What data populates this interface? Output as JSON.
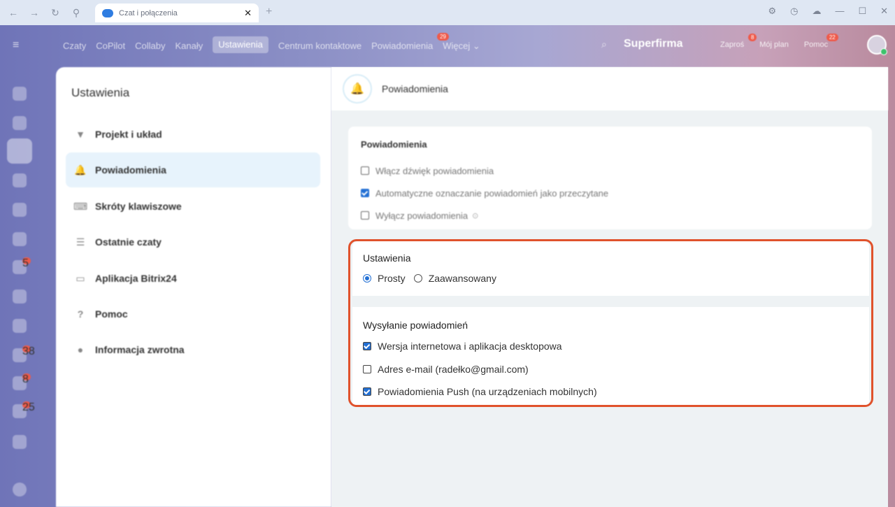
{
  "browser": {
    "tab_title": "Czat i połączenia"
  },
  "top_menu": {
    "items": [
      "Czaty",
      "CoPilot",
      "Collaby",
      "Kanały",
      "Ustawienia",
      "Centrum kontaktowe",
      "Powiadomienia",
      "Więcej ⌄"
    ],
    "notifications_badge": "29",
    "brand": "Superfirma",
    "invite": "Zaproś",
    "invite_badge": "8",
    "my_plan": "Mój plan",
    "help": "Pomoc",
    "help_badge": "22"
  },
  "rail": {
    "badges": [
      "5",
      "38",
      "8",
      "25"
    ]
  },
  "settings_panel": {
    "title": "Ustawienia",
    "items": [
      {
        "label": "Projekt i układ",
        "icon": "brush-icon"
      },
      {
        "label": "Powiadomienia",
        "icon": "bell-icon"
      },
      {
        "label": "Skróty klawiszowe",
        "icon": "keyboard-icon"
      },
      {
        "label": "Ostatnie czaty",
        "icon": "list-icon"
      },
      {
        "label": "Aplikacja Bitrix24",
        "icon": "monitor-icon"
      },
      {
        "label": "Pomoc",
        "icon": "question-icon"
      },
      {
        "label": "Informacja zwrotna",
        "icon": "chat-bubble-icon"
      }
    ]
  },
  "content": {
    "header_title": "Powiadomienia",
    "notifications_card": {
      "heading": "Powiadomienia",
      "options": [
        {
          "label": "Włącz dźwięk powiadomienia",
          "checked": false
        },
        {
          "label": "Automatyczne oznaczanie powiadomień jako przeczytane",
          "checked": true
        },
        {
          "label": "Wyłącz powiadomienia",
          "checked": false
        }
      ]
    },
    "mode_section": {
      "heading": "Ustawienia",
      "simple": "Prosty",
      "advanced": "Zaawansowany",
      "selected": "Prosty"
    },
    "sending_section": {
      "heading": "Wysyłanie powiadomień",
      "options": [
        {
          "label": "Wersja internetowa i aplikacja desktopowa",
          "checked": true
        },
        {
          "label": "Adres e-mail (radełko@gmail.com)",
          "checked": false
        },
        {
          "label": "Powiadomienia Push (na urządzeniach mobilnych)",
          "checked": true
        }
      ]
    },
    "highlight_color": "#e0522c",
    "accent_color": "#2370d4"
  }
}
